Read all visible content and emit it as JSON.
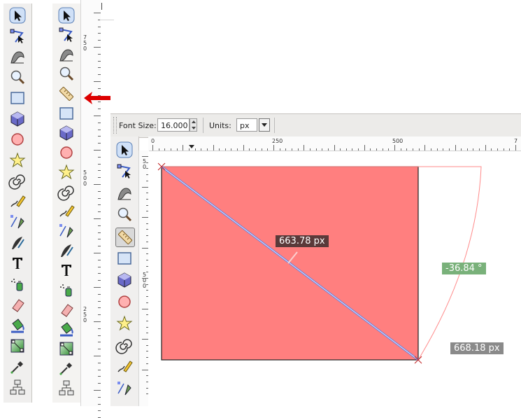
{
  "ruler_left": {
    "labels": [
      {
        "text": "7\n5\n0"
      },
      {
        "text": "5\n0\n0"
      },
      {
        "text": "2\n5\n0"
      }
    ]
  },
  "controls": {
    "font_size_label": "Font Size:",
    "font_size_value": "16.000",
    "units_label": "Units:",
    "units_value": "px"
  },
  "ruler_top": {
    "labels": [
      "0",
      "250",
      "500",
      "7"
    ]
  },
  "ruler_canvas_left": {
    "labels": [
      {
        "text": "5\n0"
      },
      {
        "text": "5\n0\n0"
      }
    ]
  },
  "measure": {
    "diagonal_length": "663.78 px",
    "angle": "-36.84 °",
    "arc_length": "668.18 px"
  },
  "colors": {
    "rect_fill": "#ff7f7f",
    "angle_label_bg": "#79b17a",
    "length_label_bg": "#5a5a5a",
    "arrow": "#dd0000"
  },
  "icons": {
    "toolbar_left": [
      "selector-icon",
      "node-icon",
      "tweak-icon",
      "zoom-icon",
      "rect-icon",
      "3dbox-icon",
      "circle-icon",
      "star-icon",
      "spiral-icon",
      "pencil-icon",
      "pen-icon",
      "calligraphy-icon",
      "text-icon",
      "spray-icon",
      "eraser-icon",
      "paint-bucket-icon",
      "gradient-icon",
      "dropper-icon",
      "connector-icon"
    ],
    "toolbar_middle": [
      "selector-icon",
      "node-icon",
      "tweak-icon",
      "zoom-icon",
      "measure-icon",
      "rect-icon",
      "3dbox-icon",
      "circle-icon",
      "star-icon",
      "spiral-icon",
      "pencil-icon",
      "pen-icon",
      "calligraphy-icon",
      "text-icon",
      "spray-icon",
      "eraser-icon",
      "paint-bucket-icon",
      "gradient-icon",
      "dropper-icon",
      "connector-icon"
    ],
    "toolbar_canvas": [
      "selector-icon",
      "node-icon",
      "tweak-icon",
      "zoom-icon",
      "measure-icon",
      "rect-icon",
      "3dbox-icon",
      "circle-icon",
      "star-icon",
      "spiral-icon",
      "pencil-icon",
      "pen-icon"
    ]
  }
}
